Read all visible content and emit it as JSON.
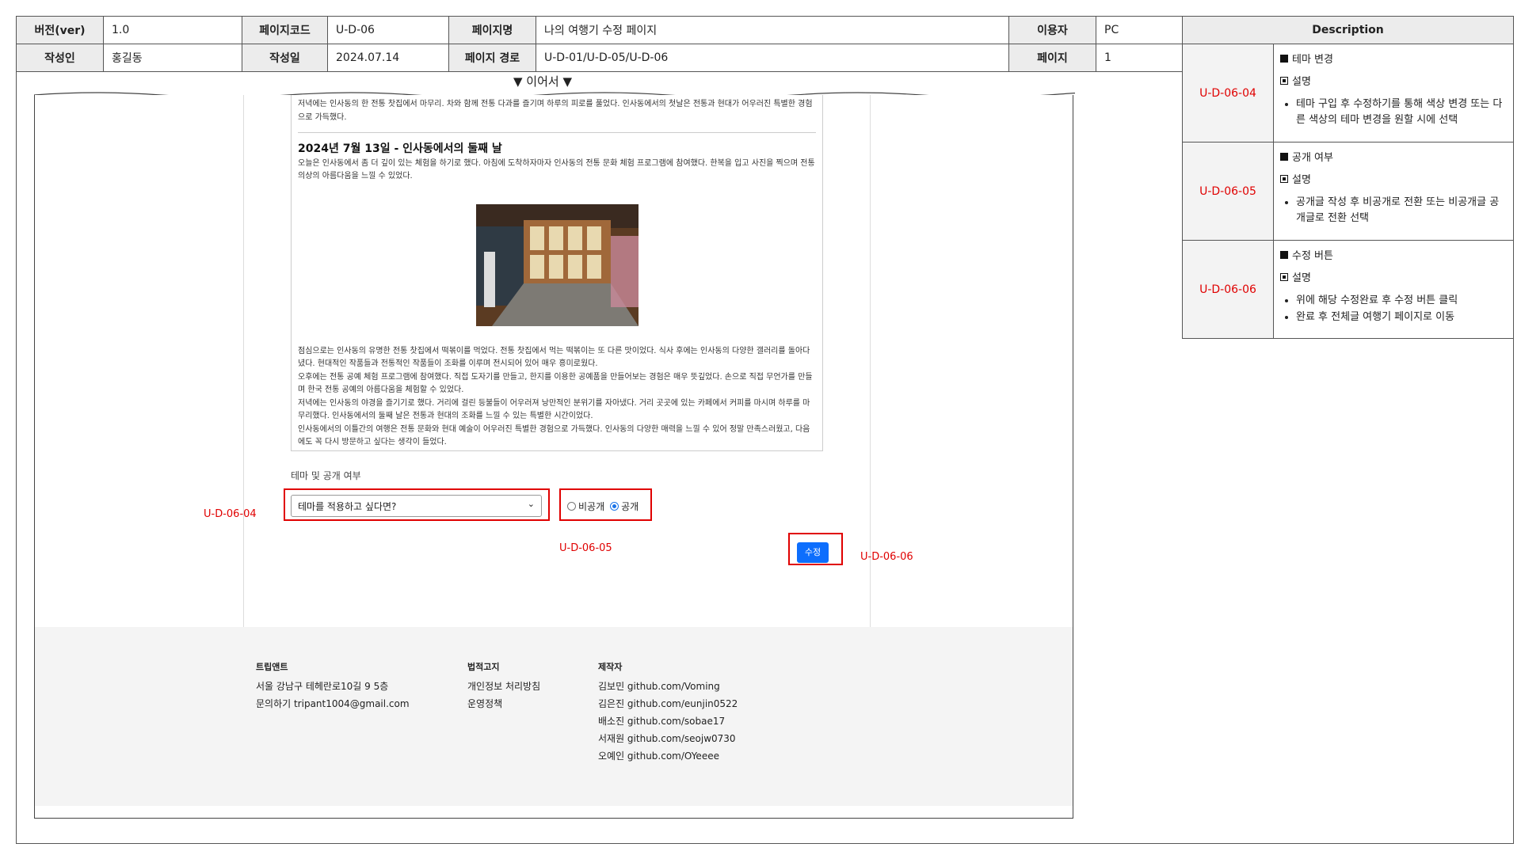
{
  "header": {
    "row1": [
      {
        "k": "버전(ver)",
        "v": "1.0"
      },
      {
        "k": "페이지코드",
        "v": "U-D-06"
      },
      {
        "k": "페이지명",
        "v": "나의 여행기 수정 페이지"
      },
      {
        "k": "이용자",
        "v": "PC"
      }
    ],
    "row2": [
      {
        "k": "작성인",
        "v": "홍길동"
      },
      {
        "k": "작성일",
        "v": "2024.07.14"
      },
      {
        "k": "페이지 경로",
        "v": "U-D-01/U-D-05/U-D-06"
      },
      {
        "k": "페이지",
        "v": "1"
      }
    ]
  },
  "continue_label": "▼ 이어서 ▼",
  "description": {
    "title": "Description",
    "items": [
      {
        "id": "U-D-06-04",
        "heading": "테마 변경",
        "sub": "설명",
        "bullets": [
          "테마 구입 후 수정하기를 통해 색상 변경 또는 다른 색상의 테마 변경을 원할 시에 선택"
        ]
      },
      {
        "id": "U-D-06-05",
        "heading": "공개 여부",
        "sub": "설명",
        "bullets": [
          "공개글 작성 후 비공개로 전환 또는 비공개글 공개글로 전환 선택"
        ]
      },
      {
        "id": "U-D-06-06",
        "heading": "수정 버튼",
        "sub": "설명",
        "bullets": [
          "위에 해당 수정완료 후 수정 버튼 클릭",
          "완료 후 전체글 여행기 페이지로 이동"
        ]
      }
    ]
  },
  "post": {
    "intro": "저녁에는 인사동의 한 전통 찻집에서 마무리. 차와 함께 전통 다과를 즐기며 하루의 피로를 풀었다. 인사동에서의 첫날은 전통과 현대가 어우러진 특별한 경험으로 가득했다.",
    "day2_title": "2024년 7월 13일 - 인사동에서의 둘째 날",
    "day2_body": "오늘은 인사동에서 좀 더 깊이 있는 체험을 하기로 했다. 아침에 도착하자마자 인사동의 전통 문화 체험 프로그램에 참여했다. 한복을 입고 사진을 찍으며 전통 의상의 아름다움을 느낄 수 있었다.",
    "paragraphs": [
      "점심으로는 인사동의 유명한 전통 찻집에서 떡볶이를 먹었다. 전통 찻집에서 먹는 떡볶이는 또 다른 맛이었다. 식사 후에는 인사동의 다양한 갤러리를 돌아다녔다. 현대적인 작품들과 전통적인 작품들이 조화를 이루며 전시되어 있어 매우 흥미로웠다.",
      "오후에는 전통 공예 체험 프로그램에 참여했다. 직접 도자기를 만들고, 한지를 이용한 공예품을 만들어보는 경험은 매우 뜻깊었다. 손으로 직접 무언가를 만들며 한국 전통 공예의 아름다움을 체험할 수 있었다.",
      "저녁에는 인사동의 야경을 즐기기로 했다. 거리에 걸린 등불들이 어우러져 낭만적인 분위기를 자아냈다. 거리 곳곳에 있는 카페에서 커피를 마시며 하루를 마무리했다. 인사동에서의 둘째 날은 전통과 현대의 조화를 느낄 수 있는 특별한 시간이었다.",
      "인사동에서의 이틀간의 여행은 전통 문화와 현대 예술이 어우러진 특별한 경험으로 가득했다. 인사동의 다양한 매력을 느낄 수 있어 정말 만족스러웠고, 다음에도 꼭 다시 방문하고 싶다는 생각이 들었다."
    ]
  },
  "form": {
    "section_label": "테마 및 공개 여부",
    "theme_select_value": "테마를 적용하고 싶다면?",
    "radio_private": "비공개",
    "radio_public": "공개",
    "selected_visibility": "공개",
    "submit_label": "수정"
  },
  "annotations": {
    "a04": "U-D-06-04",
    "a05": "U-D-06-05",
    "a06": "U-D-06-06"
  },
  "footer": {
    "brand": {
      "title": "트립앤트",
      "lines": [
        "서울 강남구 테헤란로10길 9 5층",
        "문의하기 tripant1004@gmail.com"
      ]
    },
    "legal": {
      "title": "법적고지",
      "lines": [
        "개인정보 처리방침",
        "운영정책"
      ]
    },
    "makers": {
      "title": "제작자",
      "lines": [
        "김보민 github.com/Voming",
        "김은진 github.com/eunjin0522",
        "배소진 github.com/sobae17",
        "서재원 github.com/seojw0730",
        "오예인 github.com/OYeeee"
      ]
    }
  },
  "colors": {
    "annotation": "#e00000",
    "primary_button": "#0d6efd"
  }
}
